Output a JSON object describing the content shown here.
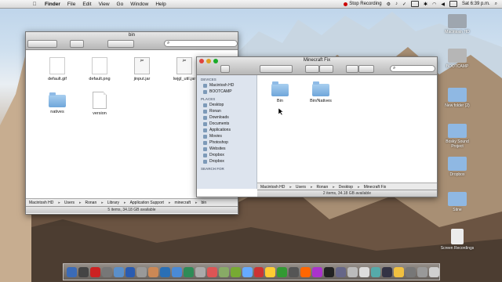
{
  "menubar": {
    "apple": "",
    "items": [
      "Finder",
      "File",
      "Edit",
      "View",
      "Go",
      "Window",
      "Help"
    ],
    "status": {
      "recording": "Stop Recording",
      "clock": "Sat 6:39 p.m."
    }
  },
  "desktop_icons": [
    {
      "label": "Macintosh HD",
      "color": "#9ea6af"
    },
    {
      "label": "BOOTCAMP",
      "color": "#b6b6b6"
    },
    {
      "label": "New folder (2)",
      "color": "#8fb8e3"
    },
    {
      "label": "Bosky Sound Project",
      "color": "#8fb8e3"
    },
    {
      "label": "Dropbox",
      "color": "#8fb8e3"
    },
    {
      "label": "Stine",
      "color": "#8fb8e3"
    },
    {
      "label": "Screen Recordings",
      "color": "#ececec"
    }
  ],
  "bin_window": {
    "title": "bin",
    "items": [
      {
        "label": "default.gif",
        "type": "img"
      },
      {
        "label": "default.png",
        "type": "img"
      },
      {
        "label": "jinput.jar",
        "type": "jar"
      },
      {
        "label": "lwjgl_util.jar",
        "type": "jar"
      },
      {
        "label": "natives",
        "type": "folder"
      },
      {
        "label": "version",
        "type": "doc"
      }
    ],
    "path": [
      "Macintosh HD",
      "Users",
      "Ronan",
      "Library",
      "Application Support",
      "minecraft",
      "bin"
    ],
    "status": "5 items, 34.18 GB available"
  },
  "fix_window": {
    "title": "Minecraft Fix",
    "search_placeholder": "",
    "sidebar": {
      "devices_header": "DEVICES",
      "devices": [
        "Macintosh HD",
        "BOOTCAMP"
      ],
      "places_header": "PLACES",
      "places": [
        "Desktop",
        "Ronan",
        "Downloads",
        "Documents",
        "Applications",
        "Movies",
        "Photoshop",
        "Websites",
        "Dropbox",
        "Dropbox"
      ],
      "search_header": "SEARCH FOR"
    },
    "items": [
      {
        "label": "Bin",
        "type": "folder"
      },
      {
        "label": "Bin/Natives",
        "type": "folder"
      }
    ],
    "path": [
      "Macintosh HD",
      "Users",
      "Ronan",
      "Desktop",
      "Minecraft Fix"
    ],
    "status": "2 items, 34.18 GB available"
  },
  "dock_colors": [
    "#3b6bb7",
    "#444",
    "#c22",
    "#777",
    "#5b8fc9",
    "#2a5bb0",
    "#999",
    "#c85",
    "#2a6fb5",
    "#4a8ad6",
    "#2e8b57",
    "#aaa",
    "#d55",
    "#8a6",
    "#7a3",
    "#6af",
    "#c33",
    "#fc3",
    "#393",
    "#555",
    "#f60",
    "#a3c",
    "#222",
    "#668",
    "#bbb",
    "#ddd",
    "#5aa",
    "#334",
    "#f0c040",
    "#777",
    "#999",
    "#d0d0d0"
  ]
}
